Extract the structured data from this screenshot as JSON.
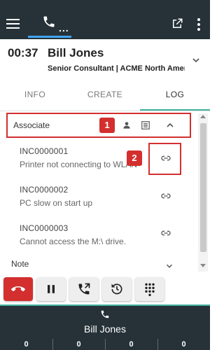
{
  "topbar": {
    "menu_icon": "hamburger-menu-icon",
    "tab_icon": "phone-icon",
    "tab_label": "...",
    "actions": [
      "external-link-icon",
      "more-vertical-icon"
    ]
  },
  "call": {
    "time": "00:37",
    "caller_name": "Bill Jones",
    "caller_subtitle": "Senior Consultant | ACME North America"
  },
  "tabs": [
    {
      "label": "INFO",
      "active": false
    },
    {
      "label": "CREATE",
      "active": false
    },
    {
      "label": "LOG",
      "active": true
    }
  ],
  "associate": {
    "label": "Associate",
    "annotation_1": "1",
    "icons": [
      "person-icon",
      "list-icon",
      "chevron-up-icon"
    ]
  },
  "incidents": [
    {
      "id": "INC0000001",
      "description": "Printer not connecting to WLAN"
    },
    {
      "id": "INC0000002",
      "description": "PC slow on start up"
    },
    {
      "id": "INC0000003",
      "description": "Cannot access the M:\\ drive."
    }
  ],
  "annotation_2": "2",
  "note": {
    "label": "Note"
  },
  "controls": [
    "end-call-icon",
    "pause-icon",
    "transfer-call-icon",
    "history-icon",
    "dialpad-icon"
  ],
  "colors": {
    "topbar": "#263238",
    "accent": "#42b2a0",
    "tab_underline": "#42a5f5",
    "annotation_red": "#d32f2f"
  },
  "footer": {
    "caller_name": "Bill Jones",
    "counts": [
      "0",
      "0",
      "0",
      "0"
    ]
  }
}
